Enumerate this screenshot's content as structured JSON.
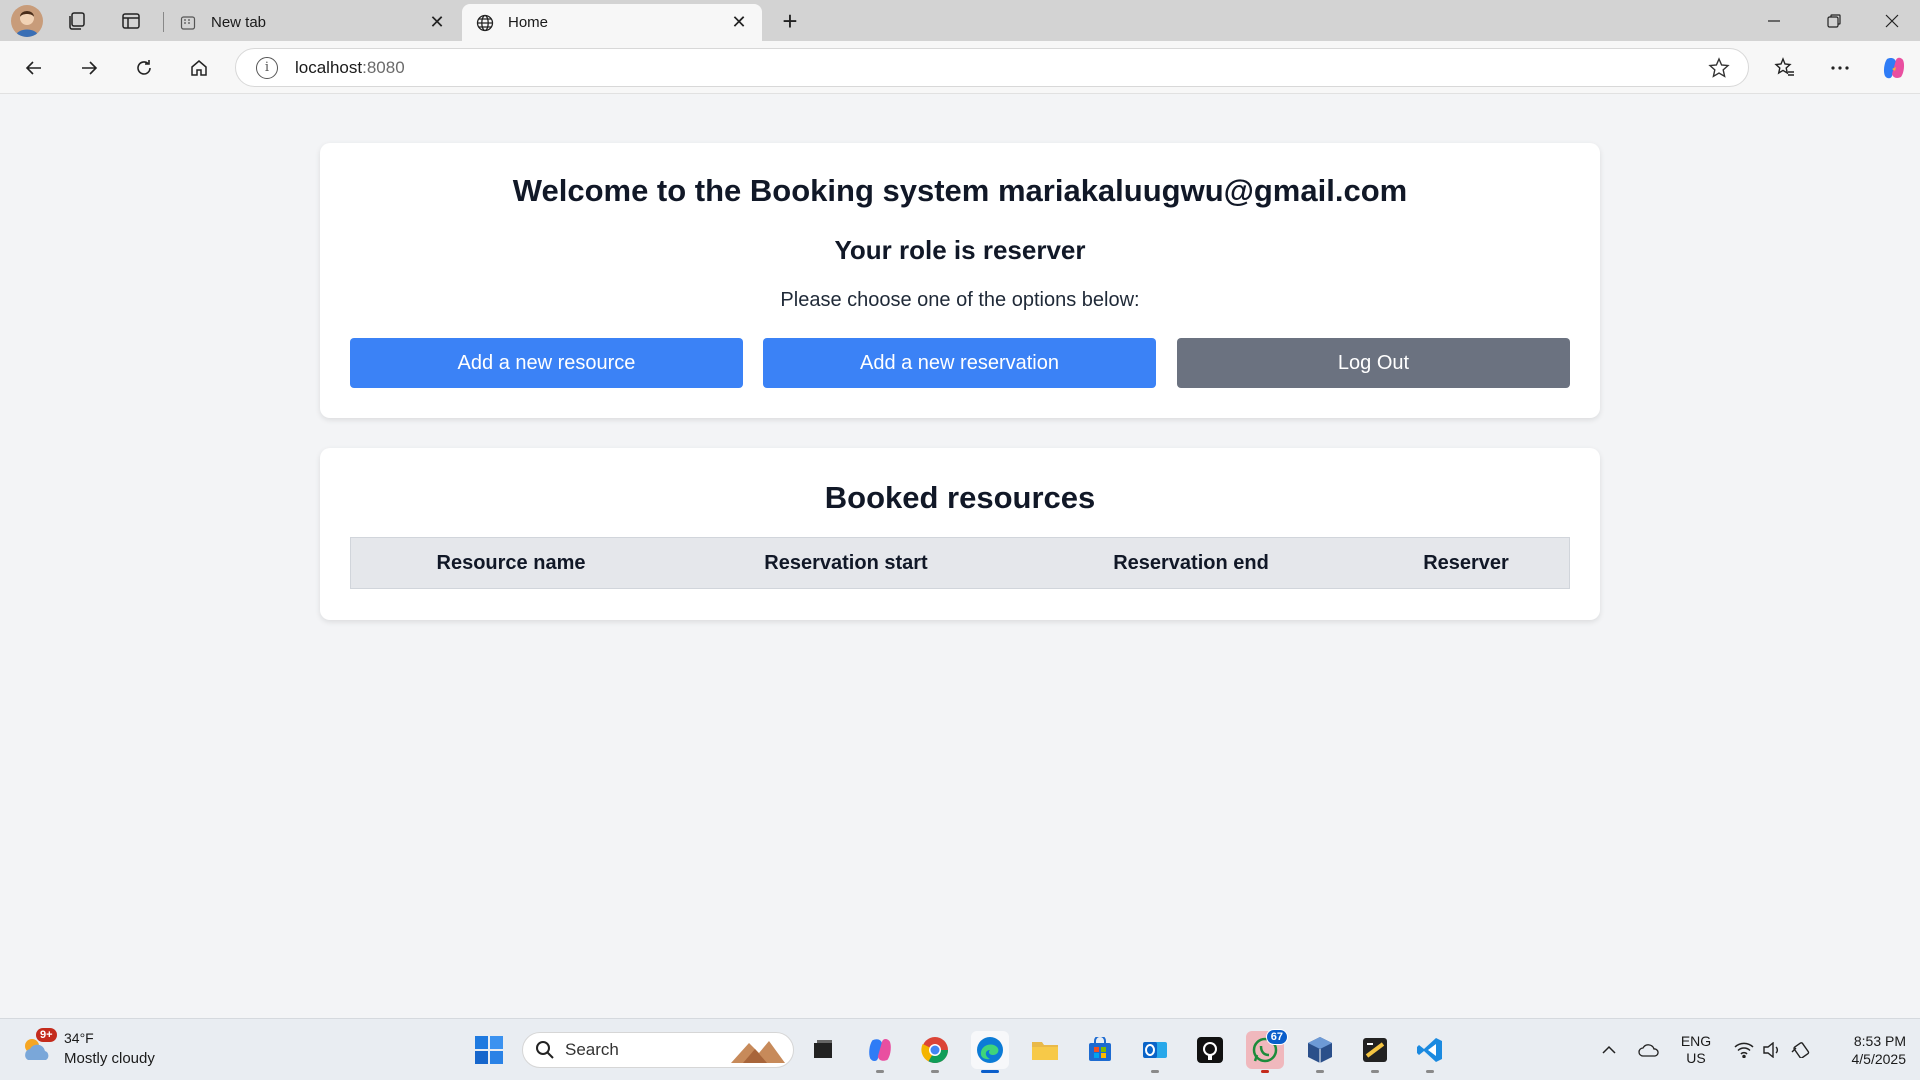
{
  "browser": {
    "tabs": [
      {
        "title": "New tab",
        "icon": "newtab-icon"
      },
      {
        "title": "Home",
        "icon": "globe-icon"
      }
    ],
    "url_host": "localhost",
    "url_port": ":8080"
  },
  "page": {
    "welcome": "Welcome to the Booking system mariakaluugwu@gmail.com",
    "role": "Your role is reserver",
    "choose": "Please choose one of the options below:",
    "buttons": {
      "add_resource": "Add a new resource",
      "add_reservation": "Add a new reservation",
      "logout": "Log Out"
    },
    "booked": {
      "title": "Booked resources",
      "columns": [
        "Resource name",
        "Reservation start",
        "Reservation end",
        "Reserver"
      ]
    },
    "colors": {
      "primary_button": "#3b82f6",
      "secondary_button": "#6b7280",
      "page_bg": "#f3f4f6"
    }
  },
  "taskbar": {
    "weather": {
      "temp": "34°F",
      "desc": "Mostly cloudy",
      "badge": "9+"
    },
    "search_label": "Search",
    "whatsapp_badge": "67",
    "lang_top": "ENG",
    "lang_bottom": "US",
    "time": "8:53 PM",
    "date": "4/5/2025"
  }
}
